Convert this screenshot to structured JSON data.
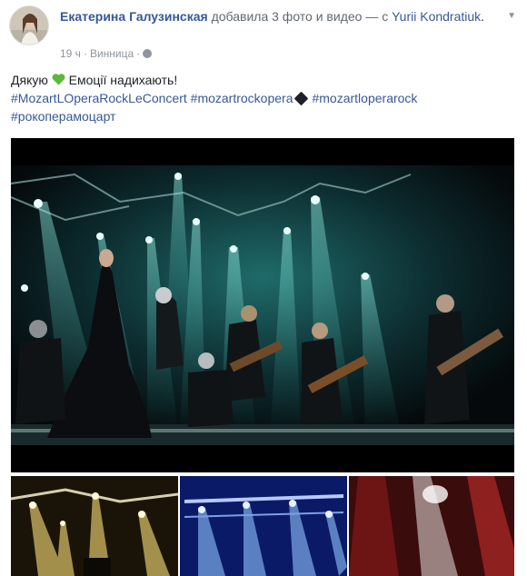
{
  "post": {
    "author": "Екатерина Галузинская",
    "action": "добавила 3 фото и видео — с",
    "tagged": "Yurii Kondratiuk",
    "tagged_end": ".",
    "time": "19 ч",
    "location": "Винница",
    "text_line": "Дякую",
    "text_after_heart": "Емоції надихають!",
    "heart_icon": "green-heart-icon",
    "hashtags": [
      "#MozartLOperaRockLeConcert",
      "#mozartrockopera",
      "#mozartloperarock",
      "#рокоперамоцарт"
    ],
    "accent_link_color": "#365899"
  },
  "media": {
    "main": "concert-video",
    "thumbnails": [
      "stage-lights-yellow",
      "stage-lights-blue",
      "stage-lights-red"
    ]
  }
}
